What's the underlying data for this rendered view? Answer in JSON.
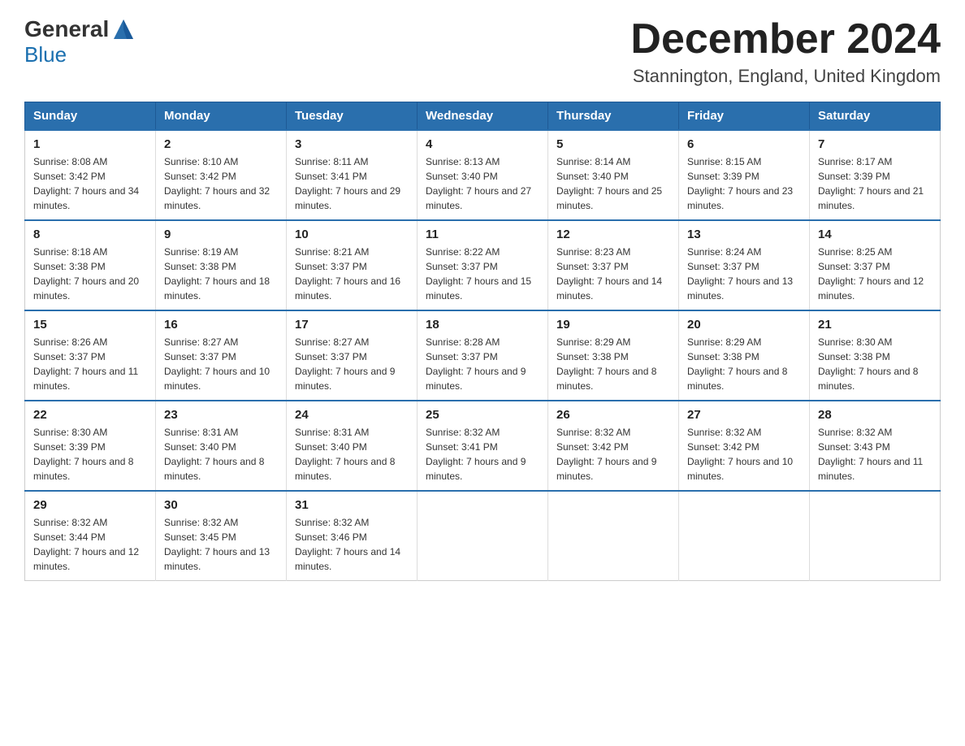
{
  "header": {
    "logo_general": "General",
    "logo_blue": "Blue",
    "month_title": "December 2024",
    "location": "Stannington, England, United Kingdom"
  },
  "weekdays": [
    "Sunday",
    "Monday",
    "Tuesday",
    "Wednesday",
    "Thursday",
    "Friday",
    "Saturday"
  ],
  "weeks": [
    [
      {
        "day": "1",
        "sunrise": "8:08 AM",
        "sunset": "3:42 PM",
        "daylight": "7 hours and 34 minutes."
      },
      {
        "day": "2",
        "sunrise": "8:10 AM",
        "sunset": "3:42 PM",
        "daylight": "7 hours and 32 minutes."
      },
      {
        "day": "3",
        "sunrise": "8:11 AM",
        "sunset": "3:41 PM",
        "daylight": "7 hours and 29 minutes."
      },
      {
        "day": "4",
        "sunrise": "8:13 AM",
        "sunset": "3:40 PM",
        "daylight": "7 hours and 27 minutes."
      },
      {
        "day": "5",
        "sunrise": "8:14 AM",
        "sunset": "3:40 PM",
        "daylight": "7 hours and 25 minutes."
      },
      {
        "day": "6",
        "sunrise": "8:15 AM",
        "sunset": "3:39 PM",
        "daylight": "7 hours and 23 minutes."
      },
      {
        "day": "7",
        "sunrise": "8:17 AM",
        "sunset": "3:39 PM",
        "daylight": "7 hours and 21 minutes."
      }
    ],
    [
      {
        "day": "8",
        "sunrise": "8:18 AM",
        "sunset": "3:38 PM",
        "daylight": "7 hours and 20 minutes."
      },
      {
        "day": "9",
        "sunrise": "8:19 AM",
        "sunset": "3:38 PM",
        "daylight": "7 hours and 18 minutes."
      },
      {
        "day": "10",
        "sunrise": "8:21 AM",
        "sunset": "3:37 PM",
        "daylight": "7 hours and 16 minutes."
      },
      {
        "day": "11",
        "sunrise": "8:22 AM",
        "sunset": "3:37 PM",
        "daylight": "7 hours and 15 minutes."
      },
      {
        "day": "12",
        "sunrise": "8:23 AM",
        "sunset": "3:37 PM",
        "daylight": "7 hours and 14 minutes."
      },
      {
        "day": "13",
        "sunrise": "8:24 AM",
        "sunset": "3:37 PM",
        "daylight": "7 hours and 13 minutes."
      },
      {
        "day": "14",
        "sunrise": "8:25 AM",
        "sunset": "3:37 PM",
        "daylight": "7 hours and 12 minutes."
      }
    ],
    [
      {
        "day": "15",
        "sunrise": "8:26 AM",
        "sunset": "3:37 PM",
        "daylight": "7 hours and 11 minutes."
      },
      {
        "day": "16",
        "sunrise": "8:27 AM",
        "sunset": "3:37 PM",
        "daylight": "7 hours and 10 minutes."
      },
      {
        "day": "17",
        "sunrise": "8:27 AM",
        "sunset": "3:37 PM",
        "daylight": "7 hours and 9 minutes."
      },
      {
        "day": "18",
        "sunrise": "8:28 AM",
        "sunset": "3:37 PM",
        "daylight": "7 hours and 9 minutes."
      },
      {
        "day": "19",
        "sunrise": "8:29 AM",
        "sunset": "3:38 PM",
        "daylight": "7 hours and 8 minutes."
      },
      {
        "day": "20",
        "sunrise": "8:29 AM",
        "sunset": "3:38 PM",
        "daylight": "7 hours and 8 minutes."
      },
      {
        "day": "21",
        "sunrise": "8:30 AM",
        "sunset": "3:38 PM",
        "daylight": "7 hours and 8 minutes."
      }
    ],
    [
      {
        "day": "22",
        "sunrise": "8:30 AM",
        "sunset": "3:39 PM",
        "daylight": "7 hours and 8 minutes."
      },
      {
        "day": "23",
        "sunrise": "8:31 AM",
        "sunset": "3:40 PM",
        "daylight": "7 hours and 8 minutes."
      },
      {
        "day": "24",
        "sunrise": "8:31 AM",
        "sunset": "3:40 PM",
        "daylight": "7 hours and 8 minutes."
      },
      {
        "day": "25",
        "sunrise": "8:32 AM",
        "sunset": "3:41 PM",
        "daylight": "7 hours and 9 minutes."
      },
      {
        "day": "26",
        "sunrise": "8:32 AM",
        "sunset": "3:42 PM",
        "daylight": "7 hours and 9 minutes."
      },
      {
        "day": "27",
        "sunrise": "8:32 AM",
        "sunset": "3:42 PM",
        "daylight": "7 hours and 10 minutes."
      },
      {
        "day": "28",
        "sunrise": "8:32 AM",
        "sunset": "3:43 PM",
        "daylight": "7 hours and 11 minutes."
      }
    ],
    [
      {
        "day": "29",
        "sunrise": "8:32 AM",
        "sunset": "3:44 PM",
        "daylight": "7 hours and 12 minutes."
      },
      {
        "day": "30",
        "sunrise": "8:32 AM",
        "sunset": "3:45 PM",
        "daylight": "7 hours and 13 minutes."
      },
      {
        "day": "31",
        "sunrise": "8:32 AM",
        "sunset": "3:46 PM",
        "daylight": "7 hours and 14 minutes."
      },
      null,
      null,
      null,
      null
    ]
  ]
}
